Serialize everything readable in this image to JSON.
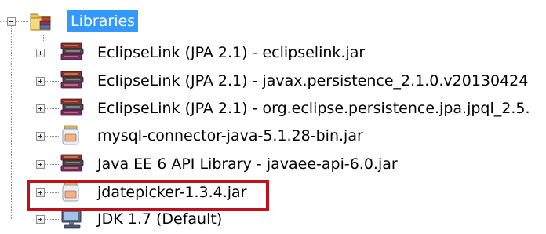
{
  "tree": {
    "root": {
      "label": "Libraries",
      "expanded": true,
      "icon": "library-folder-icon"
    },
    "items": [
      {
        "label": "EclipseLink (JPA 2.1) - eclipselink.jar",
        "icon": "book-stack-icon",
        "expander": "plus"
      },
      {
        "label": "EclipseLink (JPA 2.1) - javax.persistence_2.1.0.v20130424",
        "icon": "book-stack-icon",
        "expander": "plus"
      },
      {
        "label": "EclipseLink (JPA 2.1) - org.eclipse.persistence.jpa.jpql_2.5.",
        "icon": "book-stack-icon",
        "expander": "plus"
      },
      {
        "label": "mysql-connector-java-5.1.28-bin.jar",
        "icon": "jar-file-icon",
        "expander": "plus"
      },
      {
        "label": "Java EE 6 API Library - javaee-api-6.0.jar",
        "icon": "book-stack-icon",
        "expander": "plus"
      },
      {
        "label": "jdatepicker-1.3.4.jar",
        "icon": "jar-file-icon",
        "expander": "plus",
        "highlighted": true
      },
      {
        "label": "JDK 1.7 (Default)",
        "icon": "computer-icon",
        "expander": "plus"
      }
    ],
    "colors": {
      "selection": "#3399ff",
      "highlight_border": "#c0111b"
    }
  }
}
